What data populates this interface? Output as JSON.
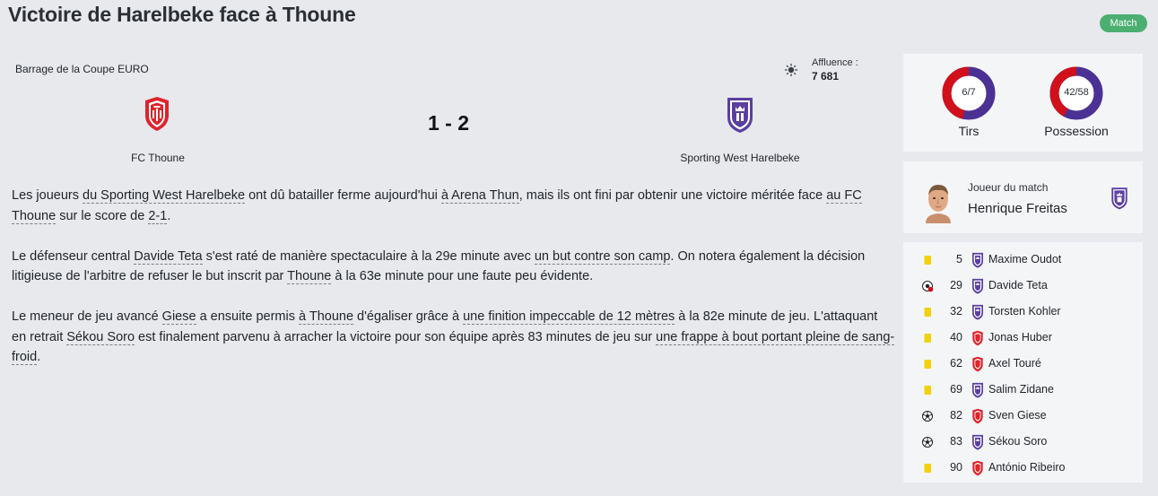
{
  "header": {
    "title": "Victoire de Harelbeke face à Thoune",
    "badge": "Match"
  },
  "match": {
    "competition": "Barrage de la Coupe EURO",
    "weather_icon": "sun-icon",
    "attendance_label": "Affluence :",
    "attendance_value": "7 681",
    "score": "1 - 2",
    "home_team": "FC Thoune",
    "away_team": "Sporting West Harelbeke",
    "home_color": "#e0232b",
    "away_color": "#5a3fa0"
  },
  "article": {
    "p1": [
      {
        "t": "Les joueurs "
      },
      {
        "t": "du Sporting West Harelbeke",
        "link": true
      },
      {
        "t": " ont dû batailler ferme aujourd'hui "
      },
      {
        "t": "à Arena Thun",
        "link": true
      },
      {
        "t": ", mais ils ont fini par obtenir une victoire méritée face "
      },
      {
        "t": "au FC Thoune",
        "link": true
      },
      {
        "t": " sur le score de "
      },
      {
        "t": "2-1",
        "link": true
      },
      {
        "t": "."
      }
    ],
    "p2": [
      {
        "t": "Le défenseur central "
      },
      {
        "t": "Davide Teta",
        "link": true
      },
      {
        "t": " s'est raté de manière spectaculaire à la 29e minute avec "
      },
      {
        "t": "un but contre son camp",
        "link": true
      },
      {
        "t": ". On notera également la décision litigieuse de l'arbitre de refuser le but inscrit par "
      },
      {
        "t": "Thoune",
        "link": true
      },
      {
        "t": " à la 63e minute pour une faute peu évidente."
      }
    ],
    "p3": [
      {
        "t": "Le meneur de jeu avancé "
      },
      {
        "t": "Giese",
        "link": true
      },
      {
        "t": " a ensuite permis "
      },
      {
        "t": "à Thoune",
        "link": true
      },
      {
        "t": " d'égaliser grâce à "
      },
      {
        "t": "une finition impeccable de 12 mètres",
        "link": true
      },
      {
        "t": " à la 82e minute de jeu. L'attaquant en retrait "
      },
      {
        "t": "Sékou Soro",
        "link": true
      },
      {
        "t": " est finalement parvenu à arracher la victoire pour son équipe après 83 minutes de jeu sur "
      },
      {
        "t": "une frappe à bout portant pleine de sang-froid",
        "link": true
      },
      {
        "t": "."
      }
    ]
  },
  "stats": {
    "shots": {
      "label": "Tirs",
      "display": "6/7",
      "home": 6,
      "away": 7,
      "home_color": "#d0101a",
      "away_color": "#4b3194"
    },
    "possession": {
      "label": "Possession",
      "display": "42/58",
      "home": 42,
      "away": 58,
      "home_color": "#d0101a",
      "away_color": "#4b3194"
    }
  },
  "motm": {
    "label": "Joueur du match",
    "name": "Henrique Freitas",
    "team": "away"
  },
  "events": [
    {
      "icon": "yellow-card-icon",
      "minute": "5",
      "team": "away",
      "player": "Maxime Oudot"
    },
    {
      "icon": "own-goal-icon",
      "minute": "29",
      "team": "away",
      "player": "Davide Teta"
    },
    {
      "icon": "yellow-card-icon",
      "minute": "32",
      "team": "away",
      "player": "Torsten Kohler"
    },
    {
      "icon": "yellow-card-icon",
      "minute": "40",
      "team": "home",
      "player": "Jonas Huber"
    },
    {
      "icon": "yellow-card-icon",
      "minute": "62",
      "team": "home",
      "player": "Axel Touré"
    },
    {
      "icon": "yellow-card-icon",
      "minute": "69",
      "team": "away",
      "player": "Salim Zidane"
    },
    {
      "icon": "goal-icon",
      "minute": "82",
      "team": "home",
      "player": "Sven Giese"
    },
    {
      "icon": "goal-icon",
      "minute": "83",
      "team": "away",
      "player": "Sékou Soro"
    },
    {
      "icon": "yellow-card-icon",
      "minute": "90",
      "team": "home",
      "player": "António Ribeiro"
    }
  ]
}
